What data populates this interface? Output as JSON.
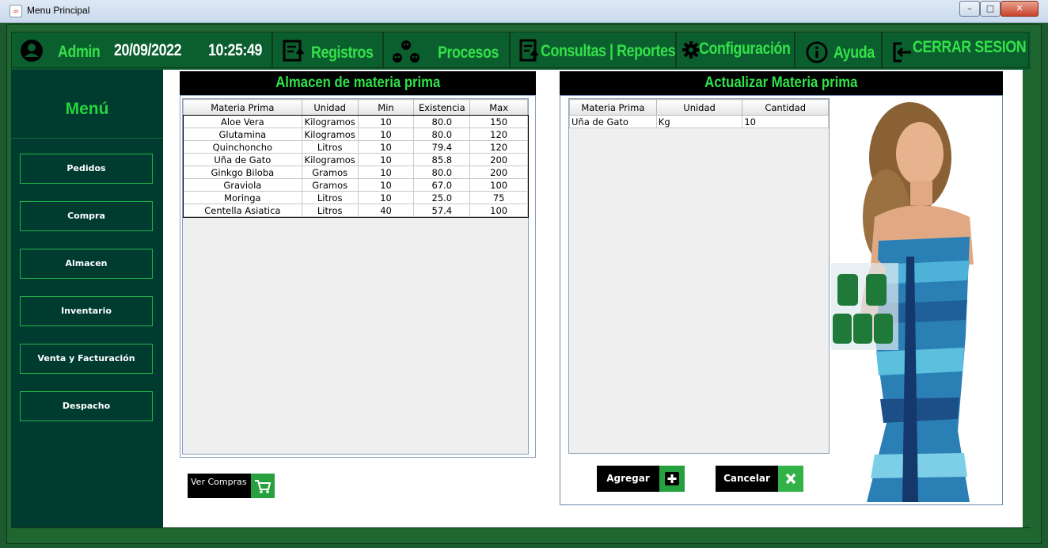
{
  "window": {
    "title": "Menu Principal",
    "min": "–",
    "max": "□",
    "close": "✕"
  },
  "topbar": {
    "user": "Admin",
    "date": "20/09/2022",
    "time": "10:25:49",
    "registros": "Registros",
    "procesos": "Procesos",
    "consultas": "Consultas | Reportes",
    "configuracion": "Configuración",
    "ayuda": "Ayuda",
    "cerrar": "CERRAR SESION"
  },
  "sidebar": {
    "title": "Menú",
    "items": [
      "Pedidos",
      "Compra",
      "Almacen",
      "Inventario",
      "Venta y Facturación",
      "Despacho"
    ]
  },
  "almacen": {
    "title": "Almacen de materia prima",
    "columns": [
      "Materia Prima",
      "Unidad",
      "Min",
      "Existencia",
      "Max"
    ],
    "rows": [
      [
        "Aloe Vera",
        "Kilogramos",
        "10",
        "80.0",
        "150"
      ],
      [
        "Glutamina",
        "Kilogramos",
        "10",
        "80.0",
        "120"
      ],
      [
        "Quinchoncho",
        "Litros",
        "10",
        "79.4",
        "120"
      ],
      [
        "Uña de Gato",
        "Kilogramos",
        "10",
        "85.8",
        "200"
      ],
      [
        "Ginkgo Biloba",
        "Gramos",
        "10",
        "80.0",
        "200"
      ],
      [
        "Graviola",
        "Gramos",
        "10",
        "67.0",
        "100"
      ],
      [
        "Moringa",
        "Litros",
        "10",
        "25.0",
        "75"
      ],
      [
        "Centella Asiatica",
        "Litros",
        "40",
        "57.4",
        "100"
      ]
    ],
    "ver_compras": "Ver Compras"
  },
  "actualizar": {
    "title": "Actualizar Materia prima",
    "columns": [
      "Materia Prima",
      "Unidad",
      "Cantidad"
    ],
    "rows": [
      [
        "Uña de Gato",
        "Kg",
        "10"
      ]
    ],
    "agregar": "Agregar",
    "cancelar": "Cancelar"
  },
  "colors": {
    "accent": "#2fe34a",
    "sidebar": "#003b2f",
    "bar": "#0b5e2e"
  }
}
